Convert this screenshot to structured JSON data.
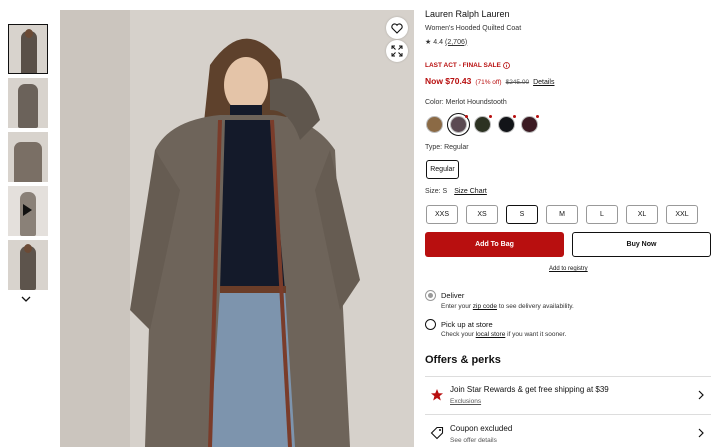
{
  "product": {
    "brand": "Lauren Ralph Lauren",
    "name": "Women's Hooded Quilted Coat",
    "rating": "4.4",
    "review_count": "(2,706)"
  },
  "pricing": {
    "sale_label": "LAST ACT - FINAL SALE",
    "price_now": "Now $70.43",
    "percent_off": "(71% off)",
    "price_was": "$245.00",
    "details_link": "Details",
    "sale_color": "#b80f0f"
  },
  "color": {
    "label": "Color: Merlot Houndstooth",
    "swatches": [
      {
        "name": "tan-houndstooth",
        "hex": "#8b6a45",
        "selected": false
      },
      {
        "name": "merlot-houndstooth",
        "hex": "#5b4a52",
        "selected": true
      },
      {
        "name": "olive",
        "hex": "#2c3222",
        "selected": false
      },
      {
        "name": "black",
        "hex": "#121418",
        "selected": false
      },
      {
        "name": "merlot",
        "hex": "#3b1a22",
        "selected": false
      }
    ]
  },
  "type": {
    "label": "Type: Regular",
    "options": [
      "Regular"
    ]
  },
  "size": {
    "label": "Size: S",
    "chart_link": "Size Chart",
    "options": [
      "XXS",
      "XS",
      "S",
      "M",
      "L",
      "XL",
      "XXL"
    ],
    "selected": "S"
  },
  "actions": {
    "add_to_bag": "Add To Bag",
    "buy_now": "Buy Now",
    "registry": "Add to registry"
  },
  "fulfillment": {
    "deliver_title": "Deliver",
    "deliver_sub_pre": "Enter your ",
    "deliver_sub_link": "zip code",
    "deliver_sub_post": " to see delivery availability.",
    "pickup_title": "Pick up at store",
    "pickup_sub_pre": "Check your ",
    "pickup_sub_link": "local store",
    "pickup_sub_post": " if you want it sooner."
  },
  "offers": {
    "title": "Offers & perks",
    "items": [
      {
        "title": "Join Star Rewards & get free shipping at $39",
        "sub": "Exclusions",
        "icon": "star-icon"
      },
      {
        "title": "Coupon excluded",
        "sub": "See offer details",
        "icon": "tag-icon"
      }
    ]
  }
}
